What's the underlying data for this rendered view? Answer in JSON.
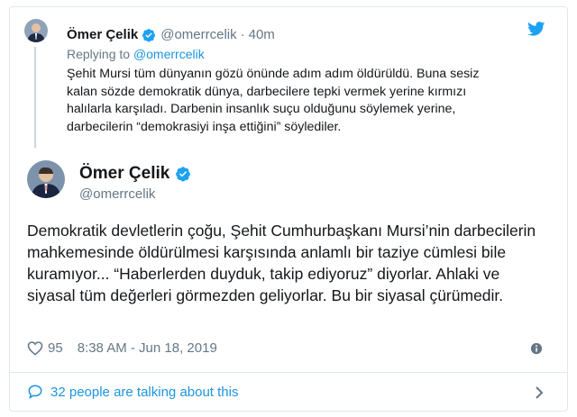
{
  "reply_tweet": {
    "author_name": "Ömer Çelik",
    "author_handle": "@omerrcelik",
    "separator": "·",
    "time": "40m",
    "replying_prefix": "Replying to ",
    "replying_to": "@omerrcelik",
    "text": "Şehit Mursi tüm dünyanın gözü önünde adım adım öldürüldü. Buna sesiz kalan sözde demokratik dünya, darbecilere tepki vermek yerine kırmızı halılarla karşıladı. Darbenin insanlık suçu olduğunu söylemek yerine, darbecilerin “demokrasiyi inşa ettiğini” söylediler."
  },
  "main_tweet": {
    "author_name": "Ömer Çelik",
    "author_handle": "@omerrcelik",
    "text": "Demokratik devletlerin çoğu, Şehit Cumhurbaşkanı Mursi’nin darbecilerin mahkemesinde öldürülmesi karşısında anlamlı bir taziye cümlesi bile kuramıyor... “Haberlerden duyduk, takip ediyoruz” diyorlar. Ahlaki ve siyasal tüm değerleri görmezden geliyorlar. Bu bir siyasal çürümedir.",
    "likes": "95",
    "timestamp": "8:38 AM - Jun 18, 2019"
  },
  "conversation": {
    "label": "32 people are talking about this"
  },
  "icons": {
    "brand": "twitter-bird-icon",
    "verified": "verified-badge-icon",
    "like": "heart-icon",
    "info": "info-icon",
    "talk": "speech-bubble-icon",
    "more": "chevron-right-icon"
  },
  "colors": {
    "brand_blue": "#1da1f2",
    "link_blue": "#1b95e0",
    "secondary_text": "#657786",
    "border": "#e1e8ed"
  }
}
